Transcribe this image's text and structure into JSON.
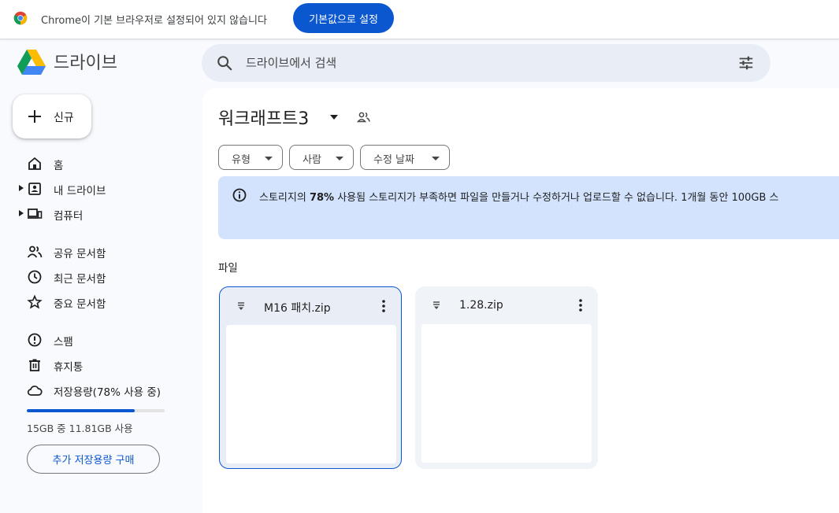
{
  "infobar": {
    "message": "Chrome이 기본 브라우저로 설정되어 있지 않습니다",
    "button_label": "기본값으로 설정",
    "logo_icon": "chrome-logo-icon"
  },
  "header": {
    "app_name": "드라이브",
    "search_placeholder": "드라이브에서 검색",
    "logo_icon": "google-drive-logo-icon",
    "search_icon": "search-icon",
    "filter_icon": "tune-icon"
  },
  "sidebar": {
    "new_label": "신규",
    "items": [
      {
        "label": "홈",
        "icon": "home-icon"
      },
      {
        "label": "내 드라이브",
        "icon": "my-drive-icon"
      },
      {
        "label": "컴퓨터",
        "icon": "computer-icon"
      },
      {
        "label": "공유 문서함",
        "icon": "people-icon"
      },
      {
        "label": "최근 문서함",
        "icon": "clock-icon"
      },
      {
        "label": "중요 문서함",
        "icon": "star-icon"
      },
      {
        "label": "스팸",
        "icon": "spam-icon"
      },
      {
        "label": "휴지통",
        "icon": "trash-icon"
      },
      {
        "label": "저장용량(78% 사용 중)",
        "icon": "cloud-icon"
      }
    ],
    "storage": {
      "used_fraction": 0.78,
      "summary": "15GB 중 11.81GB 사용",
      "buy_label": "추가 저장용량 구매"
    }
  },
  "main": {
    "folder_title": "워크래프트3",
    "filters": [
      "유형",
      "사람",
      "수정 날짜"
    ],
    "banner": {
      "text": "스토리지의 78% 사용됨 스토리지가 부족하면 파일을 만들거나 수정하거나 업로드할 수 없습니다. 1개월 동안 100GB 스",
      "bold_part": "78%"
    },
    "section_label": "파일",
    "files": [
      {
        "name": "M16 패치.zip",
        "selected": true
      },
      {
        "name": "1.28.zip",
        "selected": false
      }
    ]
  },
  "colors": {
    "accent": "#0b57d0",
    "banner_bg": "#d3e3fd",
    "page_bg": "#f8fafd",
    "search_bg": "#e9eef6"
  }
}
